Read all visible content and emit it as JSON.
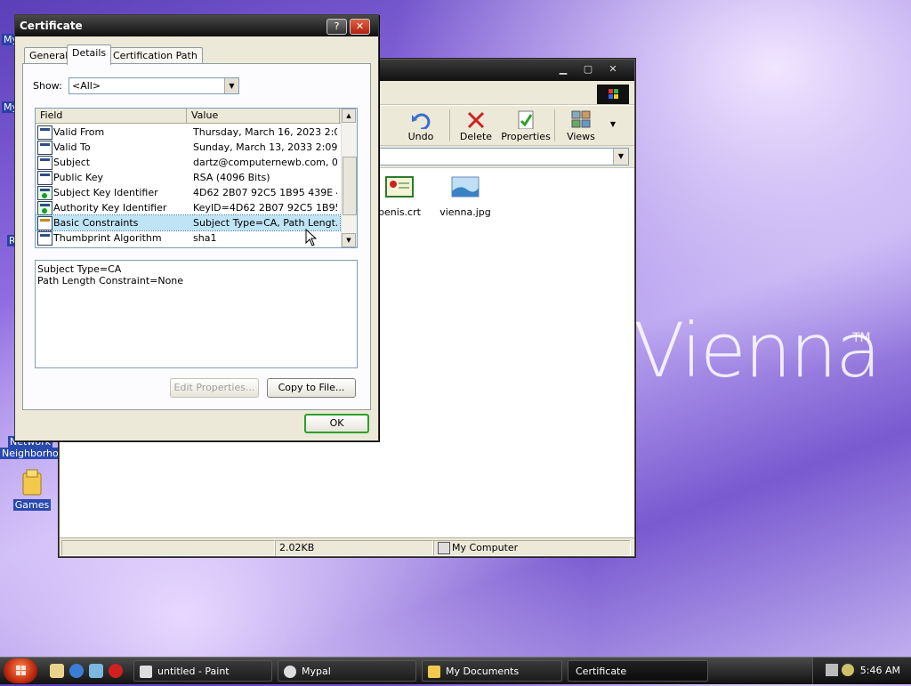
{
  "wallpaper": {
    "brand_text": "Vienna",
    "trademark": "TM"
  },
  "desktop": {
    "icons": [
      {
        "label": "Network Neighborhood",
        "line1": "Network",
        "line2": "Neighborhood"
      },
      {
        "label": "Games"
      }
    ],
    "edge_labels": [
      "My",
      "My",
      "R"
    ]
  },
  "explorer": {
    "toolbar": [
      {
        "label": "Undo",
        "icon": "undo-icon"
      },
      {
        "label": "Delete",
        "icon": "delete-icon"
      },
      {
        "label": "Properties",
        "icon": "properties-icon"
      },
      {
        "label": "Views",
        "icon": "views-icon"
      }
    ],
    "files": [
      {
        "name": "penis.crt",
        "icon": "certificate-file-icon"
      },
      {
        "name": "vienna.jpg",
        "icon": "image-file-icon"
      }
    ],
    "status": {
      "size": "2.02KB",
      "zone": "My Computer"
    }
  },
  "dialog": {
    "title": "Certificate",
    "help": "?",
    "close": "✕",
    "tabs": [
      "General",
      "Details",
      "Certification Path"
    ],
    "active_tab": "Details",
    "show_label": "Show:",
    "show_value": "<All>",
    "columns": {
      "field": "Field",
      "value": "Value"
    },
    "rows": [
      {
        "field": "Valid From",
        "value": "Thursday, March 16, 2023 2:0...",
        "icon": "cert-field-icon"
      },
      {
        "field": "Valid To",
        "value": "Sunday, March 13, 2033 2:09:...",
        "icon": "cert-field-icon"
      },
      {
        "field": "Subject",
        "value": "dartz@computernewb.com, 0...",
        "icon": "cert-field-icon"
      },
      {
        "field": "Public Key",
        "value": "RSA (4096 Bits)",
        "icon": "cert-field-icon"
      },
      {
        "field": "Subject Key Identifier",
        "value": "4D62 2B07 92C5 1B95 439E 4...",
        "icon": "cert-extension-icon"
      },
      {
        "field": "Authority Key Identifier",
        "value": "KeyID=4D62 2B07 92C5 1B95 ...",
        "icon": "cert-extension-icon"
      },
      {
        "field": "Basic Constraints",
        "value": "Subject Type=CA, Path Lengt...",
        "icon": "cert-critical-extension-icon"
      },
      {
        "field": "Thumbprint Algorithm",
        "value": "sha1",
        "icon": "cert-property-icon"
      }
    ],
    "selected_row": "Basic Constraints",
    "detail_lines": [
      "Subject Type=CA",
      "Path Length Constraint=None"
    ],
    "edit_properties": "Edit Properties...",
    "copy_to_file": "Copy to File...",
    "ok": "OK"
  },
  "taskbar": {
    "tasks": [
      {
        "label": "untitled - Paint"
      },
      {
        "label": "Mypal"
      },
      {
        "label": "My Documents"
      },
      {
        "label": "Certificate"
      }
    ],
    "clock": "5:46 AM"
  },
  "colors": {
    "selection": "#bfe4f6",
    "default_button": "#2aa02a",
    "close_button": "#c22a10"
  }
}
